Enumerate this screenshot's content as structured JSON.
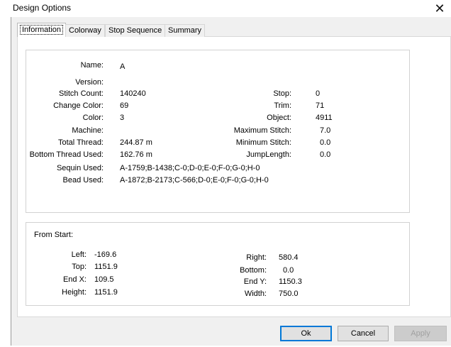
{
  "window": {
    "title": "Design Options",
    "close_glyph": "✕"
  },
  "tabs": [
    "Information",
    "Colorway",
    "Stop Sequence",
    "Summary"
  ],
  "info": {
    "name_label": "Name:",
    "name_value": "A",
    "version_label": "Version:",
    "stitch_count_label": "Stitch Count:",
    "stitch_count_value": "140240",
    "change_color_label": "Change Color:",
    "change_color_value": "69",
    "color_label": "Color:",
    "color_value": "3",
    "machine_label": "Machine:",
    "total_thread_label": "Total Thread:",
    "total_thread_value": "244.87 m",
    "bottom_thread_label": "Bottom Thread Used:",
    "bottom_thread_value": "162.76 m",
    "sequin_label": "Sequin Used:",
    "sequin_value": "A-1759;B-1438;C-0;D-0;E-0;F-0;G-0;H-0",
    "bead_label": "Bead Used:",
    "bead_value": "A-1872;B-2173;C-566;D-0;E-0;F-0;G-0;H-0",
    "stop_label": "Stop:",
    "stop_value": "0",
    "trim_label": "Trim:",
    "trim_value": "71",
    "object_label": "Object:",
    "object_value": "4911",
    "max_stitch_label": "Maximum Stitch:",
    "max_stitch_value": "7.0",
    "min_stitch_label": "Minimum Stitch:",
    "min_stitch_value": "0.0",
    "jump_length_label": "JumpLength:",
    "jump_length_value": "0.0"
  },
  "from_start": {
    "heading": "From Start:",
    "left_label": "Left:",
    "left_value": "-169.6",
    "top_label": "Top:",
    "top_value": "1151.9",
    "endx_label": "End X:",
    "endx_value": "109.5",
    "height_label": "Height:",
    "height_value": "1151.9",
    "right_label": "Right:",
    "right_value": "580.4",
    "bottom_label": "Bottom:",
    "bottom_value": "0.0",
    "endy_label": "End Y:",
    "endy_value": "1150.3",
    "width_label": "Width:",
    "width_value": "750.0"
  },
  "buttons": {
    "ok": "Ok",
    "cancel": "Cancel",
    "apply": "Apply"
  }
}
